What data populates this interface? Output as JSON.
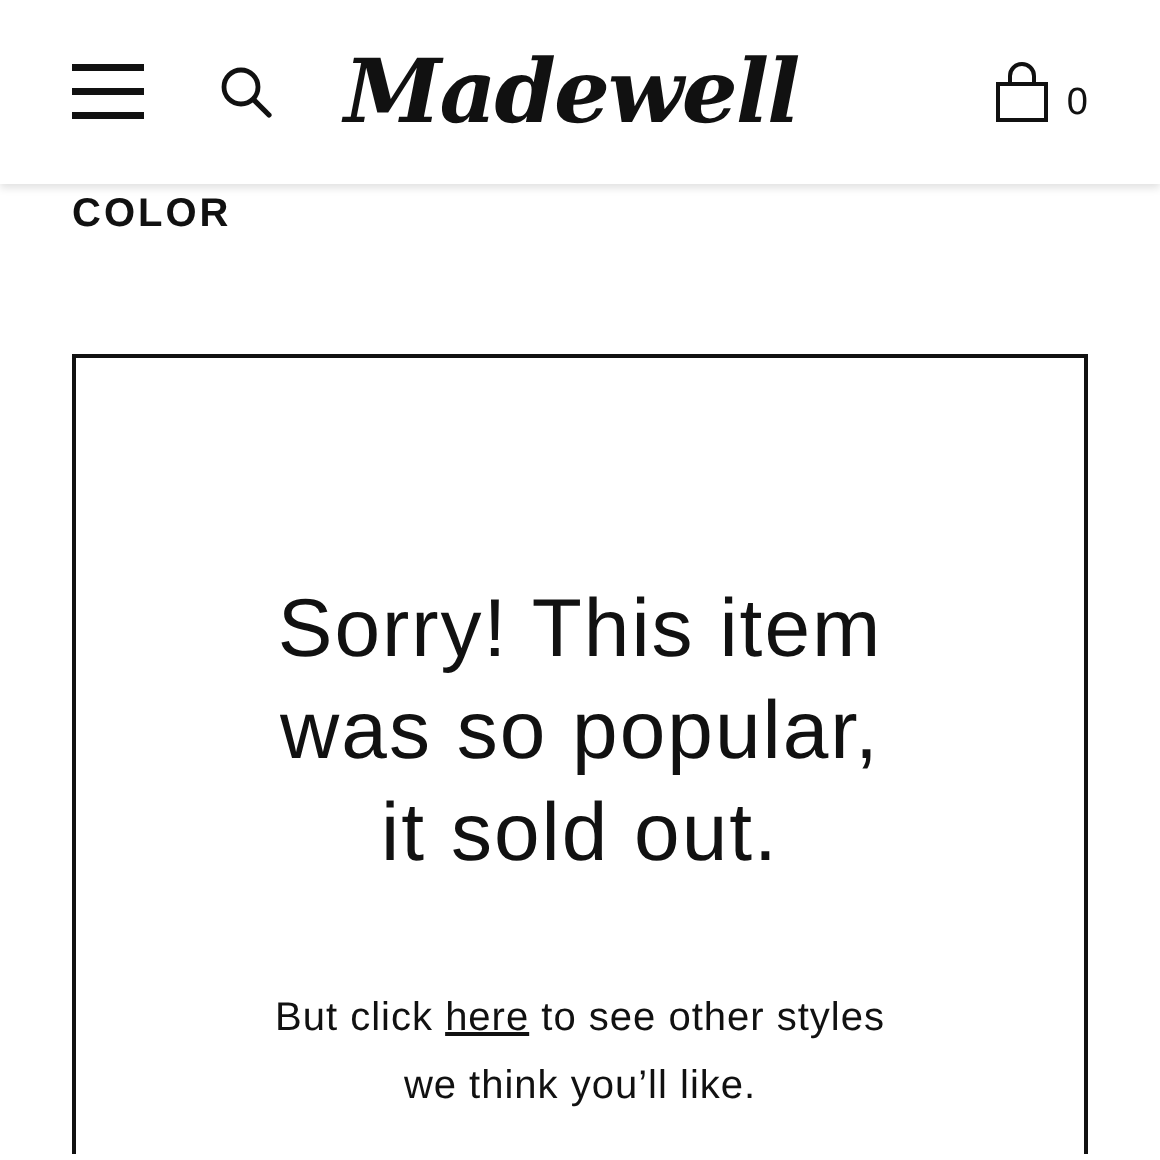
{
  "header": {
    "logo": "Madewell",
    "cart_count": "0"
  },
  "section_label": "COLOR",
  "message": {
    "heading_lines": [
      "Sorry! This item",
      "was so popular,",
      "it sold out."
    ],
    "body": {
      "before": "But click ",
      "link": "here",
      "after": " to see other styles we think you’ll like."
    }
  }
}
